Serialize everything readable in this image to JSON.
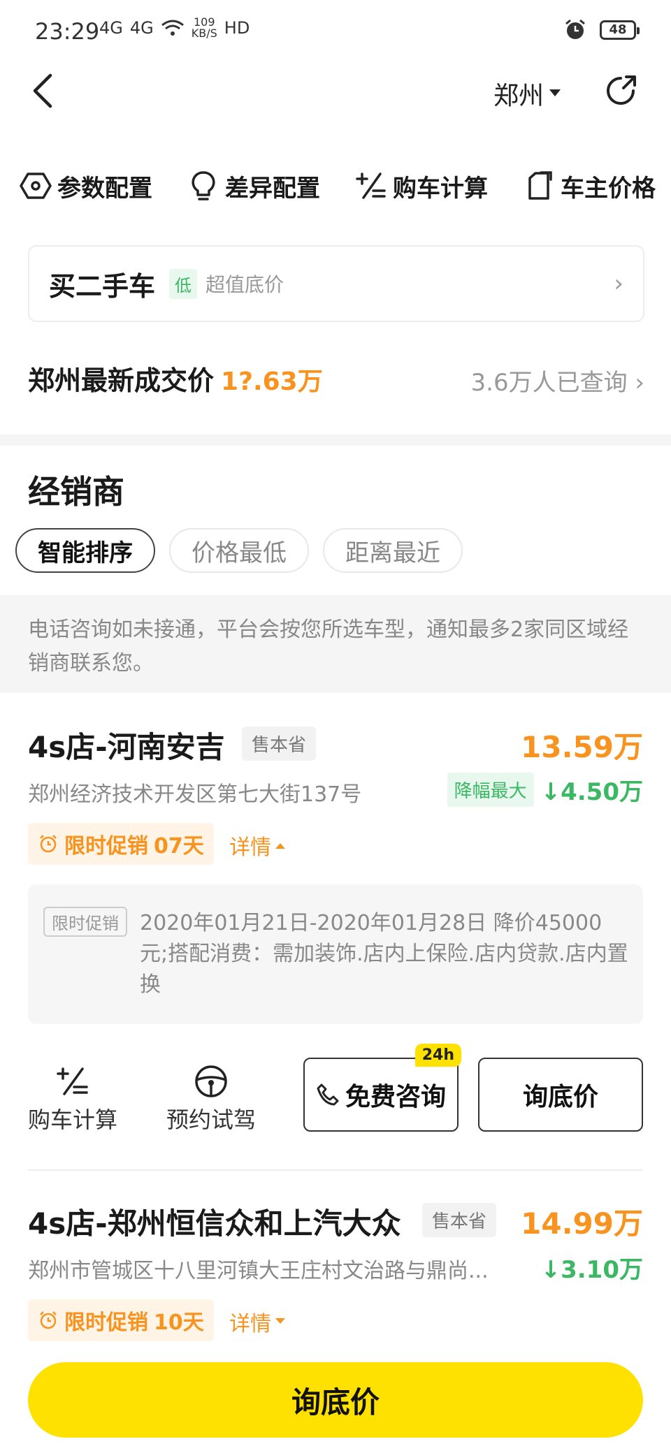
{
  "status": {
    "time": "23:29",
    "net1": "4G",
    "net2": "4G",
    "speed_num": "109",
    "speed_unit": "KB/S",
    "hd": "HD",
    "battery": "48"
  },
  "header": {
    "city": "郑州"
  },
  "quick_tabs": [
    {
      "label": "参数配置",
      "icon": "hexagon-gear-icon"
    },
    {
      "label": "差异配置",
      "icon": "lightbulb-icon"
    },
    {
      "label": "购车计算",
      "icon": "calculator-icon"
    },
    {
      "label": "车主价格",
      "icon": "price-tag-icon"
    }
  ],
  "used_car": {
    "title": "买二手车",
    "badge": "低",
    "subtitle": "超值底价"
  },
  "latest": {
    "label": "郑州最新成交价",
    "price": "1?.63万",
    "queried": "3.6万人已查询"
  },
  "dealers_title": "经销商",
  "sorts": [
    "智能排序",
    "价格最低",
    "距离最近"
  ],
  "notice": "电话咨询如未接通，平台会按您所选车型，通知最多2家同区域经销商联系您。",
  "dealer1": {
    "name": "4s店-河南安吉",
    "badge": "售本省",
    "price": "13.59万",
    "address": "郑州经济技术开发区第七大街137号",
    "drop_tag": "降幅最大",
    "drop": "4.50万",
    "promo_label": "限时促销",
    "promo_days": "07天",
    "detail": "详情",
    "promo_tag": "限时促销",
    "promo_text": "2020年01月21日-2020年01月28日 降价45000元;搭配消费：需加装饰.店内上保险.店内贷款.店内置换",
    "action_calc": "购车计算",
    "action_drive": "预约试驾",
    "consult": "免费咨询",
    "badge24": "24h",
    "ask": "询底价"
  },
  "dealer2": {
    "name": "4s店-郑州恒信众和上汽大众",
    "badge": "售本省",
    "price": "14.99万",
    "address": "郑州市管城区十八里河镇大王庄村文治路与鼎尚...",
    "drop": "3.10万",
    "promo_label": "限时促销",
    "promo_days": "10天",
    "detail": "详情"
  },
  "bottom_button": "询底价",
  "colors": {
    "accent": "#f7931e",
    "green": "#3cb864",
    "yellow": "#ffe100"
  }
}
